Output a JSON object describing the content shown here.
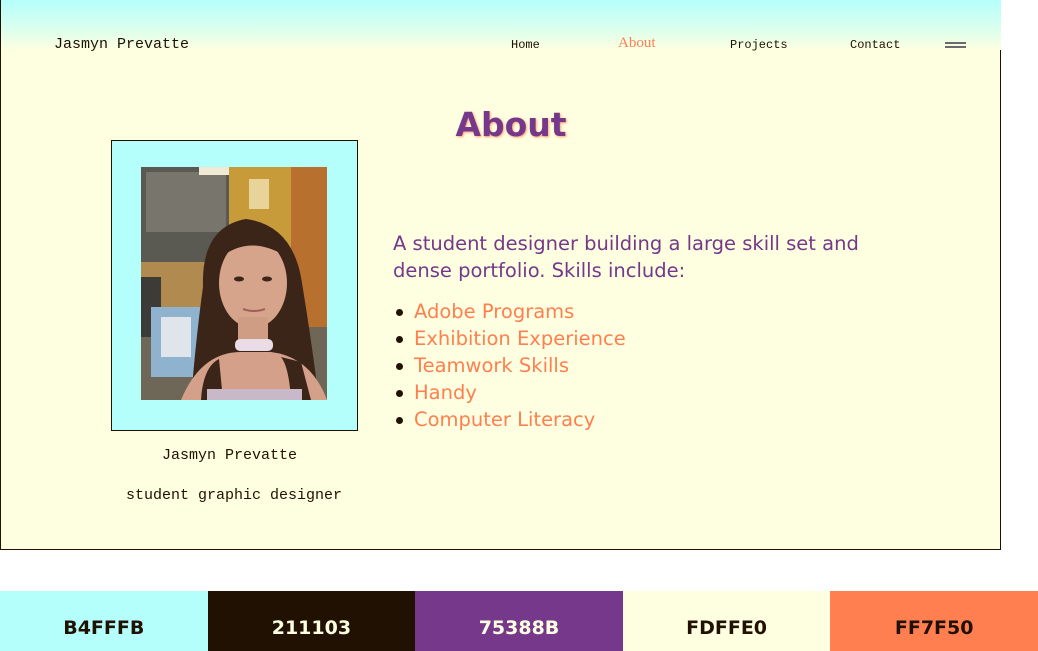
{
  "site": {
    "brand": "Jasmyn Prevatte",
    "nav": {
      "home": "Home",
      "about": "About",
      "projects": "Projects",
      "contact": "Contact"
    },
    "menu_icon": "hamburger-menu-icon",
    "title": "About",
    "profile": {
      "photo_alt": "Jasmyn Prevatte portrait",
      "name": "Jasmyn Prevatte",
      "role": "student graphic designer"
    },
    "intro": "A student designer building a large skill set and dense portfolio. Skills include:",
    "skills": [
      "Adobe Programs",
      "Exhibition Experience",
      "Teamwork Skills",
      "Handy",
      "Computer Literacy"
    ]
  },
  "palette": [
    {
      "label": "B4FFFB",
      "color": "#B4FFFB",
      "text_color": "#211103"
    },
    {
      "label": "211103",
      "color": "#211103",
      "text_color": "#FDFFE0"
    },
    {
      "label": "75388B",
      "color": "#75388B",
      "text_color": "#FDFFE0"
    },
    {
      "label": "FDFFE0",
      "color": "#FDFFE0",
      "text_color": "#211103"
    },
    {
      "label": "FF7F50",
      "color": "#FF7F50",
      "text_color": "#211103"
    }
  ],
  "colors": {
    "cyan": "#B4FFFB",
    "dark": "#211103",
    "purple": "#75388B",
    "cream": "#FDFFE0",
    "coral": "#FF7F50"
  }
}
